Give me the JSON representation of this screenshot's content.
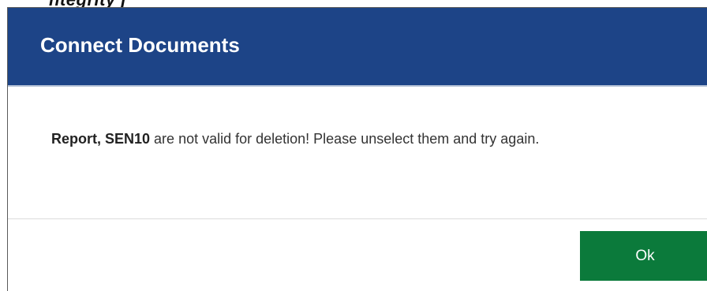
{
  "backdrop": {
    "text": "ntegrity j"
  },
  "dialog": {
    "title": "Connect Documents",
    "message": {
      "items": "Report, SEN10",
      "text": " are not valid for deletion! Please unselect them and try again."
    },
    "ok_label": "Ok"
  },
  "colors": {
    "header": "#1d4487",
    "ok_button": "#0b7a3b",
    "text": "#333333"
  }
}
